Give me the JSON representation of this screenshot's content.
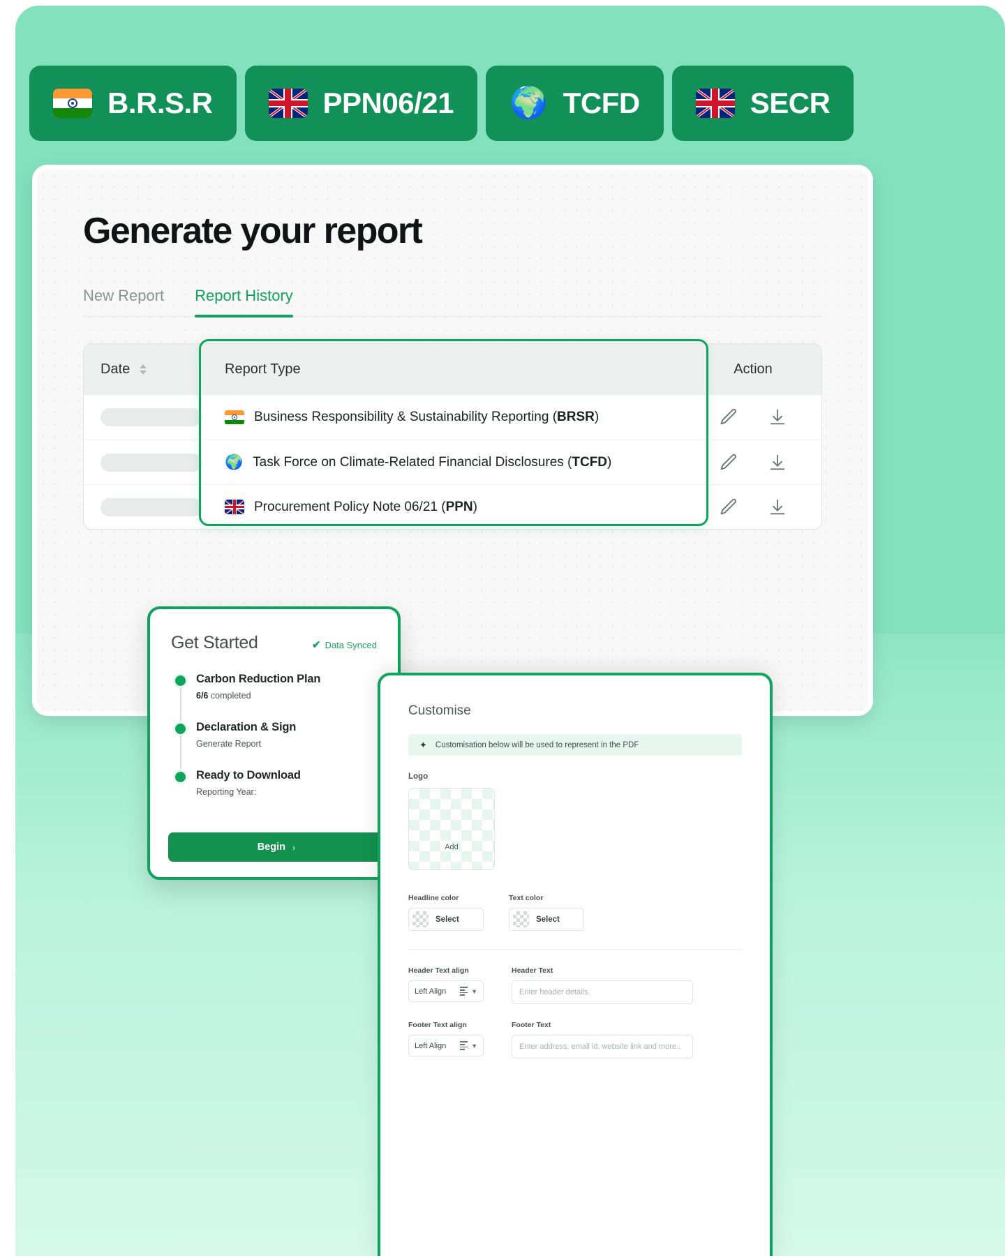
{
  "badges": [
    {
      "label": "B.R.S.R",
      "icon": "flag-india-icon"
    },
    {
      "label": "PPN06/21",
      "icon": "flag-uk-icon"
    },
    {
      "label": "TCFD",
      "icon": "globe-icon"
    },
    {
      "label": "SECR",
      "icon": "flag-uk-icon"
    }
  ],
  "main": {
    "title": "Generate your report",
    "tabs": [
      {
        "label": "New Report",
        "active": false
      },
      {
        "label": "Report History",
        "active": true
      }
    ],
    "table": {
      "columns": {
        "date": "Date",
        "report_type": "Report Type",
        "action": "Action"
      },
      "rows": [
        {
          "date": "",
          "icon": "flag-india-icon",
          "type_prefix": "Business Responsibility & Sustainability Reporting (",
          "type_abbr": "BRSR",
          "type_suffix": ")"
        },
        {
          "date": "",
          "icon": "globe-icon",
          "type_prefix": "Task Force on Climate-Related Financial Disclosures (",
          "type_abbr": "TCFD",
          "type_suffix": ")"
        },
        {
          "date": "",
          "icon": "flag-uk-icon",
          "type_prefix": "Procurement Policy Note 06/21 (",
          "type_abbr": "PPN",
          "type_suffix": ")"
        }
      ],
      "action_icons": [
        "edit-pencil-icon",
        "download-icon"
      ]
    }
  },
  "get_started": {
    "title": "Get Started",
    "sync_label": "Data Synced",
    "sync_check": "✔",
    "steps": [
      {
        "title": "Carbon Reduction Plan",
        "sub_bold": "6/6",
        "sub": "completed"
      },
      {
        "title": "Declaration & Sign",
        "sub_bold": "",
        "sub": "Generate Report"
      },
      {
        "title": "Ready to Download",
        "sub_bold": "",
        "sub": "Reporting Year:"
      }
    ],
    "begin_label": "Begin",
    "begin_arrow": "›"
  },
  "customise": {
    "title": "Customise",
    "banner": "Customisation below will be used to represent in the PDF",
    "banner_icon": "sparkle-icon",
    "logo_label": "Logo",
    "logo_add": "Add",
    "headline_color_label": "Headline color",
    "headline_color_value": "Select",
    "text_color_label": "Text color",
    "text_color_value": "Select",
    "header_align_label": "Header Text align",
    "header_align_value": "Left Align",
    "header_text_label": "Header Text",
    "header_text_placeholder": "Enter header details.",
    "footer_align_label": "Footer Text align",
    "footer_align_value": "Left Align",
    "footer_text_label": "Footer Text",
    "footer_text_placeholder": "Enter address, email id, website link and more.."
  },
  "colors": {
    "brand_green": "#0fa45c",
    "badge_green": "#119158",
    "mint_bg": "#83e1bd"
  }
}
